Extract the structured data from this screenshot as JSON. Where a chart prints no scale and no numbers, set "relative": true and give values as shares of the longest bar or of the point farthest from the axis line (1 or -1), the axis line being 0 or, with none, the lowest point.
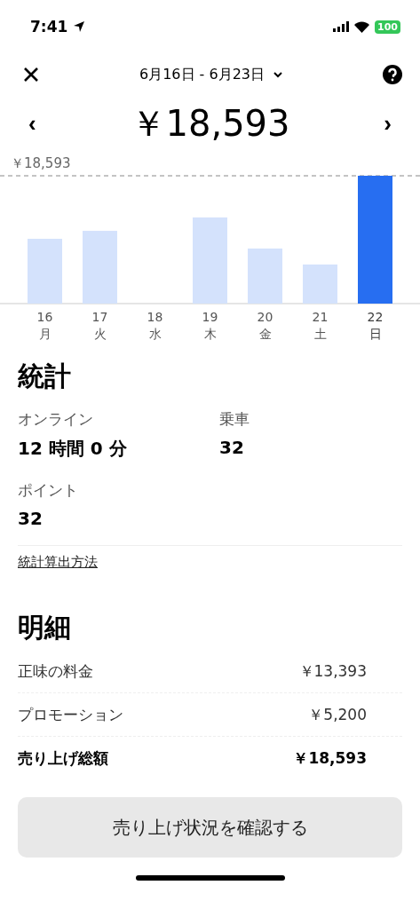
{
  "status_bar": {
    "time": "7:41",
    "battery": "100"
  },
  "header": {
    "date_range": "6月16日 - 6月23日"
  },
  "total": {
    "prev": "‹",
    "amount": "￥18,593",
    "next": "›"
  },
  "chart": {
    "bars": [
      {
        "selected": false
      },
      {
        "selected": false
      },
      {
        "selected": false
      },
      {
        "selected": false
      },
      {
        "selected": false
      },
      {
        "selected": false
      },
      {
        "selected": true
      }
    ],
    "chart_data": {
      "type": "bar",
      "relative": true,
      "categories": [
        "16 月",
        "17 火",
        "18 水",
        "19 木",
        "20 金",
        "21 土",
        "22 日"
      ],
      "values": [
        0.507,
        0.569,
        0,
        0.674,
        0.431,
        0.306,
        1
      ],
      "annotations": [
        {
          "text": "￥18,593"
        }
      ]
    }
  },
  "stats": {
    "title": "統計",
    "items": [
      {
        "label": "オンライン",
        "value": "12 時間 0 分"
      },
      {
        "label": "乗車",
        "value": "32"
      },
      {
        "label": "ポイント",
        "value": "32"
      }
    ],
    "link": "統計算出方法"
  },
  "breakdown": {
    "title": "明細",
    "rows": [
      {
        "label": "正味の料金",
        "value": "￥13,393",
        "kind": "normal"
      },
      {
        "label": "プロモーション",
        "value": "￥5,200",
        "kind": "normal"
      },
      {
        "label": "売り上げ総額",
        "value": "￥18,593",
        "kind": "total"
      }
    ]
  },
  "button": "売り上げ状況を確認する"
}
